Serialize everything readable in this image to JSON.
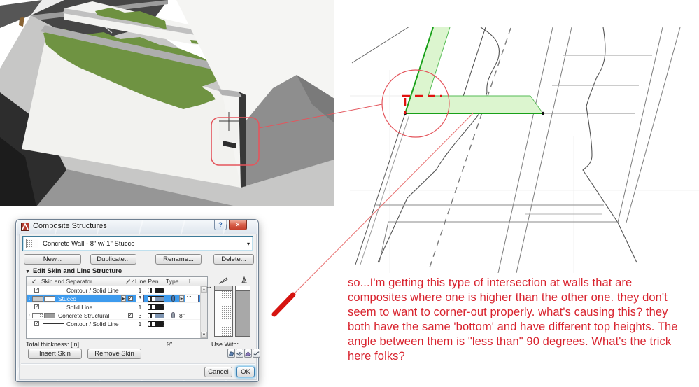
{
  "annotation": {
    "question_text": "so...I'm getting this type of intersection at walls that are composites where one is higher than the other one. they don't seem to want to corner-out properly. what's causing this? they both have the same 'bottom' and have different top heights. The angle between them is \"less than\" 90 degrees. What's the trick here folks?",
    "text_color": "#d8232e"
  },
  "colors": {
    "selection_blue": "#3d9bee",
    "marker_red": "#e01310",
    "leader_red": "#e87272",
    "wall_green_fill": "#dcf5cf",
    "wall_green_line": "#18a018"
  },
  "icons": {
    "collapse": "▼",
    "expand": "▶",
    "check": "✓",
    "drag": "↕",
    "arrow_right": "→",
    "scroll_up": "▲",
    "scroll_down": "▼",
    "help": "?",
    "close": "×",
    "dropdown": "▾",
    "thickness_header": "Ι"
  },
  "dialog": {
    "title": "Composite Structures",
    "selector": {
      "value": "Concrete Wall - 8\" w/ 1\" Stucco"
    },
    "buttons": {
      "new": "New...",
      "duplicate": "Duplicate...",
      "rename": "Rename...",
      "delete": "Delete..."
    },
    "section_label": "Edit Skin and Line Structure",
    "table": {
      "headers": {
        "skin": "Skin and Separator",
        "line_pen": "Line Pen",
        "type": "Type"
      },
      "rows": [
        {
          "name": "Contour / Solid Line",
          "pen": "1"
        },
        {
          "name": "Stucco",
          "pen": "3",
          "thickness": "1\""
        },
        {
          "name": "Solid Line",
          "pen": "1"
        },
        {
          "name": "Concrete Structural",
          "pen": "3",
          "thickness": "8\""
        },
        {
          "name": "Contour / Solid Line",
          "pen": "1"
        }
      ]
    },
    "total_thickness_label": "Total thickness: [in]",
    "total_thickness_value": "9\"",
    "insert_skin": "Insert Skin",
    "remove_skin": "Remove Skin",
    "use_with_label": "Use With:",
    "cancel": "Cancel",
    "ok": "OK"
  }
}
